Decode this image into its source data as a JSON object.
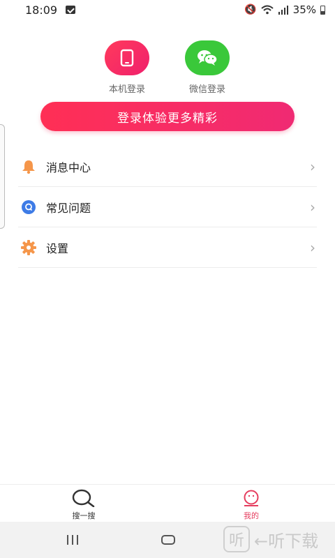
{
  "status_bar": {
    "time": "18:09",
    "battery": "35%"
  },
  "login": {
    "options": [
      {
        "label": "本机登录",
        "icon": "phone-icon",
        "color": "#f0206c"
      },
      {
        "label": "微信登录",
        "icon": "wechat-icon",
        "color": "#3ac83a"
      }
    ],
    "banner": "登录体验更多精彩"
  },
  "menu": {
    "items": [
      {
        "label": "消息中心",
        "icon": "bell-icon",
        "color": "#f5964a"
      },
      {
        "label": "常见问题",
        "icon": "question-icon",
        "color": "#3d7be6"
      },
      {
        "label": "设置",
        "icon": "gear-icon",
        "color": "#f5964a"
      }
    ]
  },
  "tabbar": {
    "tabs": [
      {
        "label": "搜一搜",
        "icon": "search-icon"
      },
      {
        "label": "我的",
        "icon": "profile-icon",
        "active": true
      }
    ]
  },
  "watermark": {
    "badge": "听",
    "text": "←听下载"
  },
  "colors": {
    "accent": "#f02a73",
    "wechat": "#3ac83a",
    "active_tab": "#e53d5e"
  }
}
